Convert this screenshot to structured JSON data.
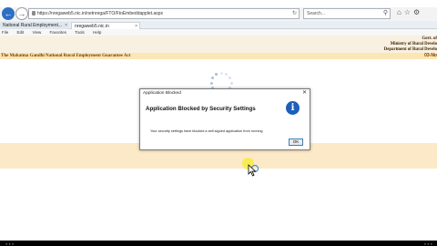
{
  "browser": {
    "url": "https://nregaweb5.nic.in/netnrega/FTO/FtoEmbeddapplet.aspx",
    "search_placeholder": "Search...",
    "tabs": [
      {
        "label": "National Rural Employment..."
      },
      {
        "label": "nregaweb5.nic.in"
      }
    ],
    "menu": [
      "File",
      "Edit",
      "View",
      "Favorites",
      "Tools",
      "Help"
    ]
  },
  "header": {
    "gov_line": "Govt. of",
    "ministry_line": "Ministry of Rural Develo",
    "department_line": "Department of Rural Develo",
    "title": "The Mahatma Gandhi National Rural Employment Guarantee Act",
    "date": "03-No"
  },
  "dialog": {
    "window_title": "Application Blocked",
    "heading": "Application Blocked by Security Settings",
    "message": "Your security settings have blocked a self-signed application from running",
    "ok_label": "OK",
    "close_glyph": "✕",
    "info_glyph": "i"
  },
  "colors": {
    "banner": "#f8f1e2",
    "title_bar": "#fbe7b5",
    "info_icon": "#1d5fb8",
    "cursor_highlight": "#f7ec45"
  },
  "icons": {
    "back": "back-arrow-icon",
    "forward": "forward-arrow-icon",
    "lock": "lock-icon",
    "search": "search-icon",
    "home": "home-icon",
    "star": "favorites-star-icon",
    "gear": "gear-icon"
  }
}
